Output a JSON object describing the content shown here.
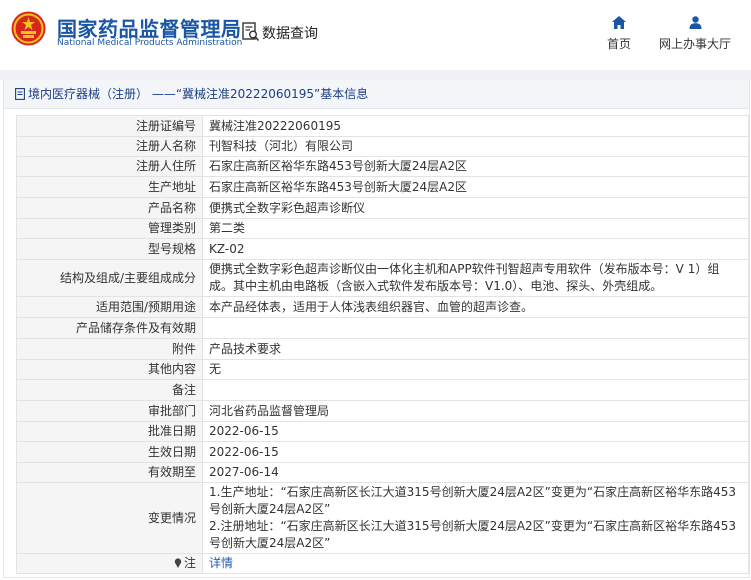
{
  "header": {
    "brand_cn": "国家药品监督管理局",
    "brand_en": "National Medical Products Administration",
    "query_label": "数据查询",
    "nav": [
      {
        "label": "首页",
        "icon": "home-icon"
      },
      {
        "label": "网上办事大厅",
        "icon": "user-icon"
      }
    ]
  },
  "panel": {
    "title": "境内医疗器械（注册） ——“冀械注准20222060195”基本信息"
  },
  "rows": [
    {
      "label": "注册证编号",
      "value": "冀械注准20222060195"
    },
    {
      "label": "注册人名称",
      "value": "刊智科技（河北）有限公司"
    },
    {
      "label": "注册人住所",
      "value": "石家庄高新区裕华东路453号创新大厦24层A2区"
    },
    {
      "label": "生产地址",
      "value": "石家庄高新区裕华东路453号创新大厦24层A2区"
    },
    {
      "label": "产品名称",
      "value": "便携式全数字彩色超声诊断仪"
    },
    {
      "label": "管理类别",
      "value": "第二类"
    },
    {
      "label": "型号规格",
      "value": "KZ-02"
    },
    {
      "label": "结构及组成/主要组成成分",
      "value": "便携式全数字彩色超声诊断仪由一体化主机和APP软件刊智超声专用软件（发布版本号：V 1）组成。其中主机由电路板（含嵌入式软件发布版本号：V1.0）、电池、探头、外壳组成。"
    },
    {
      "label": "适用范围/预期用途",
      "value": "本产品经体表，适用于人体浅表组织器官、血管的超声诊查。"
    },
    {
      "label": "产品储存条件及有效期",
      "value": ""
    },
    {
      "label": "附件",
      "value": "产品技术要求"
    },
    {
      "label": "其他内容",
      "value": "无"
    },
    {
      "label": "备注",
      "value": ""
    },
    {
      "label": "审批部门",
      "value": "河北省药品监督管理局"
    },
    {
      "label": "批准日期",
      "value": "2022-06-15"
    },
    {
      "label": "生效日期",
      "value": "2022-06-15"
    },
    {
      "label": "有效期至",
      "value": "2027-06-14"
    },
    {
      "label": "变更情况",
      "value": "1.生产地址：“石家庄高新区长江大道315号创新大厦24层A2区”变更为“石家庄高新区裕华东路453号创新大厦24层A2区”\n2.注册地址：“石家庄高新区长江大道315号创新大厦24层A2区”变更为“石家庄高新区裕华东路453号创新大厦24层A2区”"
    }
  ],
  "note": {
    "label": "注",
    "link": "详情",
    "icon": "pin-icon"
  },
  "colors": {
    "brand_blue": "#1a56a6",
    "link_blue": "#2a5bb5",
    "emblem_red": "#d7261e",
    "emblem_gold": "#f5c518"
  }
}
